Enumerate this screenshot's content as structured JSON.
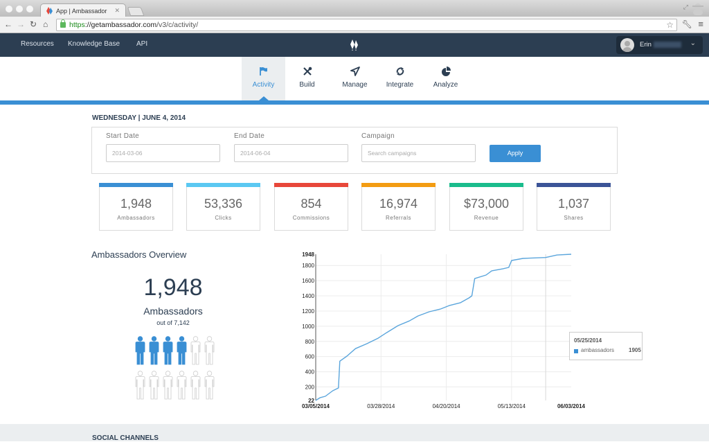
{
  "browser": {
    "tab_title": "App | Ambassador",
    "url_scheme": "https",
    "url_host": "://getambassador.com",
    "url_path": "/v3/c/activity/"
  },
  "header": {
    "links": [
      "Resources",
      "Knowledge Base",
      "API"
    ],
    "user_name": "Erin"
  },
  "nav": {
    "items": [
      {
        "label": "Activity",
        "icon": "flag-icon",
        "active": true
      },
      {
        "label": "Build",
        "icon": "tools-icon",
        "active": false
      },
      {
        "label": "Manage",
        "icon": "navigate-arrow-icon",
        "active": false
      },
      {
        "label": "Integrate",
        "icon": "sync-icon",
        "active": false
      },
      {
        "label": "Analyze",
        "icon": "pie-chart-icon",
        "active": false
      }
    ]
  },
  "date_heading": "WEDNESDAY | JUNE 4, 2014",
  "filters": {
    "start_label": "Start Date",
    "start_value": "2014-03-06",
    "end_label": "End Date",
    "end_value": "2014-06-04",
    "campaign_label": "Campaign",
    "campaign_placeholder": "Search campaigns",
    "apply_label": "Apply"
  },
  "stats": [
    {
      "value": "1,948",
      "label": "Ambassadors",
      "color": "#3a8fd4"
    },
    {
      "value": "53,336",
      "label": "Clicks",
      "color": "#5bc8f2"
    },
    {
      "value": "854",
      "label": "Commissions",
      "color": "#e8473a"
    },
    {
      "value": "16,974",
      "label": "Referrals",
      "color": "#f39c12"
    },
    {
      "value": "$73,000",
      "label": "Revenue",
      "color": "#1abc8c"
    },
    {
      "value": "1,037",
      "label": "Shares",
      "color": "#3b5497"
    }
  ],
  "overview": {
    "title": "Ambassadors Overview",
    "count": "1,948",
    "label": "Ambassadors",
    "sub": "out of 7,142",
    "people_filled": 4,
    "people_total": 12
  },
  "tooltip": {
    "date": "05/25/2014",
    "series": "ambassadors",
    "value": "1905"
  },
  "social_title": "SOCIAL CHANNELS",
  "chart_data": {
    "type": "line",
    "title": "",
    "xlabel": "",
    "ylabel": "",
    "series": [
      {
        "name": "ambassadors",
        "color": "#5aa5dc",
        "x_days": [
          0,
          1.5,
          3.4,
          6,
          8,
          8.5,
          11,
          14,
          18,
          22,
          25,
          29,
          33,
          36,
          40,
          44,
          47,
          51,
          54,
          55,
          56,
          60,
          62,
          66,
          68,
          69,
          73,
          81,
          85,
          90
        ],
        "values": [
          22,
          58,
          77,
          150,
          186,
          540,
          606,
          705,
          770,
          843,
          916,
          1008,
          1070,
          1135,
          1190,
          1227,
          1272,
          1310,
          1373,
          1400,
          1628,
          1674,
          1730,
          1757,
          1775,
          1866,
          1893,
          1905,
          1938,
          1948
        ]
      }
    ],
    "x_start": "03/05/2014",
    "x_end": "06/03/2014",
    "x_ticks": [
      {
        "label": "03/05/2014",
        "day": 0,
        "bold": true
      },
      {
        "label": "03/28/2014",
        "day": 23,
        "bold": false
      },
      {
        "label": "04/20/2014",
        "day": 46,
        "bold": false
      },
      {
        "label": "05/13/2014",
        "day": 69,
        "bold": false
      },
      {
        "label": "06/03/2014",
        "day": 90,
        "bold": true
      }
    ],
    "y_ticks": [
      {
        "label": "22",
        "value": 22,
        "bold": true
      },
      {
        "label": "200",
        "value": 200
      },
      {
        "label": "400",
        "value": 400
      },
      {
        "label": "600",
        "value": 600
      },
      {
        "label": "800",
        "value": 800
      },
      {
        "label": "1000",
        "value": 1000
      },
      {
        "label": "1200",
        "value": 1200
      },
      {
        "label": "1400",
        "value": 1400
      },
      {
        "label": "1600",
        "value": 1600
      },
      {
        "label": "1800",
        "value": 1800
      },
      {
        "label": "1948",
        "value": 1948,
        "bold": true
      }
    ],
    "ylim": [
      22,
      1948
    ],
    "xlim_days": [
      0,
      90
    ],
    "hover_day": 81,
    "grid": true,
    "legend": "none"
  }
}
